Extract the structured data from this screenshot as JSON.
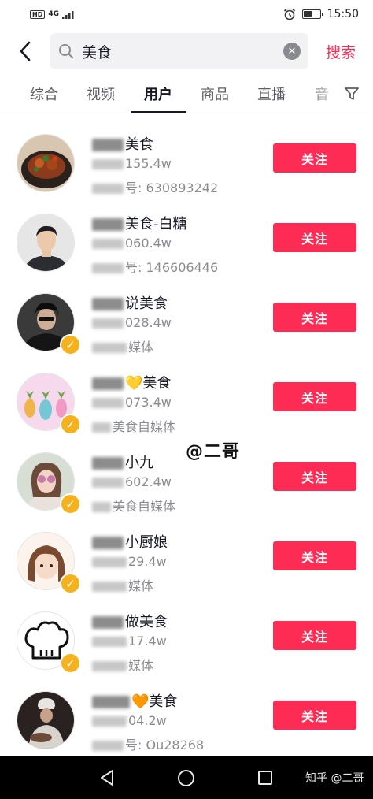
{
  "status_bar": {
    "network_badge": "HD",
    "signal": "4G",
    "time": "15:50",
    "battery_level": 0.55
  },
  "search": {
    "query": "美食",
    "submit_label": "搜索"
  },
  "tabs": [
    "综合",
    "视频",
    "用户",
    "商品",
    "直播",
    "音"
  ],
  "active_tab": "用户",
  "follow_label": "关注",
  "users": [
    {
      "name": "美食",
      "followers": "155.4w",
      "line2": "630893242",
      "line2_prefix": "号:",
      "verified": false
    },
    {
      "name": "美食-白糖",
      "followers": "060.4w",
      "line2": "146606446",
      "line2_prefix": "号:",
      "verified": false
    },
    {
      "name": "说美食",
      "followers": "028.4w",
      "line2": "媒体",
      "line2_prefix": "",
      "verified": true
    },
    {
      "name": "💛美食",
      "followers": "073.4w",
      "line2": "美食自媒体",
      "line2_prefix": "",
      "verified": true
    },
    {
      "name": "小九",
      "followers": "602.4w",
      "line2": "美食自媒体",
      "line2_prefix": "",
      "verified": true
    },
    {
      "name": "小厨娘",
      "followers": "29.4w",
      "line2": "媒体",
      "line2_prefix": "",
      "verified": true
    },
    {
      "name": "做美食",
      "followers": "17.4w",
      "line2": "媒体",
      "line2_prefix": "",
      "verified": true
    },
    {
      "name": "🧡美食",
      "followers": "04.2w",
      "line2": "Ou28268",
      "line2_prefix": "号:",
      "verified": false
    }
  ],
  "watermark": "@二哥",
  "nav_watermark": "知乎 @二哥",
  "colors": {
    "accent": "#fe2c55",
    "verified": "#f6b21c"
  }
}
